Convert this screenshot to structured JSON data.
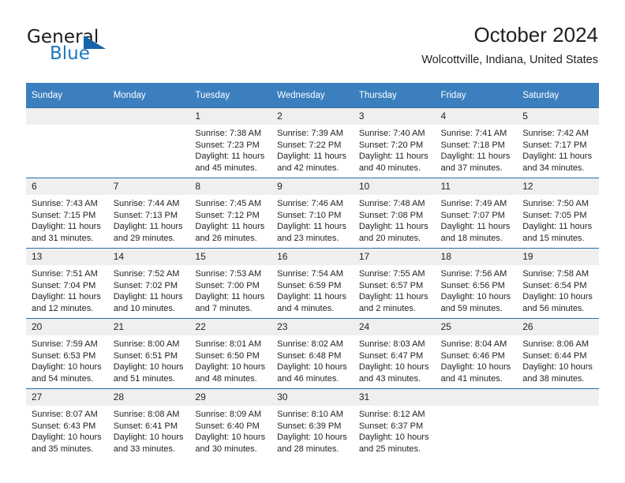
{
  "brand": {
    "name_part1": "General",
    "name_part2": "Blue",
    "triangle_icon": "triangle-icon",
    "accent_color": "#1c78c0"
  },
  "header": {
    "title": "October 2024",
    "subtitle": "Wolcottville, Indiana, United States"
  },
  "colors": {
    "header_row": "#3b7fbf",
    "row_border": "#2b6ca8",
    "daynum_background": "#efefef",
    "text": "#231f20"
  },
  "weekdays": [
    "Sunday",
    "Monday",
    "Tuesday",
    "Wednesday",
    "Thursday",
    "Friday",
    "Saturday"
  ],
  "labels": {
    "sunrise": "Sunrise:",
    "sunset": "Sunset:",
    "daylight": "Daylight:"
  },
  "weeks": [
    [
      {
        "day": "",
        "empty": true
      },
      {
        "day": "",
        "empty": true
      },
      {
        "day": "1",
        "sunrise": "Sunrise: 7:38 AM",
        "sunset": "Sunset: 7:23 PM",
        "daylight": "Daylight: 11 hours and 45 minutes."
      },
      {
        "day": "2",
        "sunrise": "Sunrise: 7:39 AM",
        "sunset": "Sunset: 7:22 PM",
        "daylight": "Daylight: 11 hours and 42 minutes."
      },
      {
        "day": "3",
        "sunrise": "Sunrise: 7:40 AM",
        "sunset": "Sunset: 7:20 PM",
        "daylight": "Daylight: 11 hours and 40 minutes."
      },
      {
        "day": "4",
        "sunrise": "Sunrise: 7:41 AM",
        "sunset": "Sunset: 7:18 PM",
        "daylight": "Daylight: 11 hours and 37 minutes."
      },
      {
        "day": "5",
        "sunrise": "Sunrise: 7:42 AM",
        "sunset": "Sunset: 7:17 PM",
        "daylight": "Daylight: 11 hours and 34 minutes."
      }
    ],
    [
      {
        "day": "6",
        "sunrise": "Sunrise: 7:43 AM",
        "sunset": "Sunset: 7:15 PM",
        "daylight": "Daylight: 11 hours and 31 minutes."
      },
      {
        "day": "7",
        "sunrise": "Sunrise: 7:44 AM",
        "sunset": "Sunset: 7:13 PM",
        "daylight": "Daylight: 11 hours and 29 minutes."
      },
      {
        "day": "8",
        "sunrise": "Sunrise: 7:45 AM",
        "sunset": "Sunset: 7:12 PM",
        "daylight": "Daylight: 11 hours and 26 minutes."
      },
      {
        "day": "9",
        "sunrise": "Sunrise: 7:46 AM",
        "sunset": "Sunset: 7:10 PM",
        "daylight": "Daylight: 11 hours and 23 minutes."
      },
      {
        "day": "10",
        "sunrise": "Sunrise: 7:48 AM",
        "sunset": "Sunset: 7:08 PM",
        "daylight": "Daylight: 11 hours and 20 minutes."
      },
      {
        "day": "11",
        "sunrise": "Sunrise: 7:49 AM",
        "sunset": "Sunset: 7:07 PM",
        "daylight": "Daylight: 11 hours and 18 minutes."
      },
      {
        "day": "12",
        "sunrise": "Sunrise: 7:50 AM",
        "sunset": "Sunset: 7:05 PM",
        "daylight": "Daylight: 11 hours and 15 minutes."
      }
    ],
    [
      {
        "day": "13",
        "sunrise": "Sunrise: 7:51 AM",
        "sunset": "Sunset: 7:04 PM",
        "daylight": "Daylight: 11 hours and 12 minutes."
      },
      {
        "day": "14",
        "sunrise": "Sunrise: 7:52 AM",
        "sunset": "Sunset: 7:02 PM",
        "daylight": "Daylight: 11 hours and 10 minutes."
      },
      {
        "day": "15",
        "sunrise": "Sunrise: 7:53 AM",
        "sunset": "Sunset: 7:00 PM",
        "daylight": "Daylight: 11 hours and 7 minutes."
      },
      {
        "day": "16",
        "sunrise": "Sunrise: 7:54 AM",
        "sunset": "Sunset: 6:59 PM",
        "daylight": "Daylight: 11 hours and 4 minutes."
      },
      {
        "day": "17",
        "sunrise": "Sunrise: 7:55 AM",
        "sunset": "Sunset: 6:57 PM",
        "daylight": "Daylight: 11 hours and 2 minutes."
      },
      {
        "day": "18",
        "sunrise": "Sunrise: 7:56 AM",
        "sunset": "Sunset: 6:56 PM",
        "daylight": "Daylight: 10 hours and 59 minutes."
      },
      {
        "day": "19",
        "sunrise": "Sunrise: 7:58 AM",
        "sunset": "Sunset: 6:54 PM",
        "daylight": "Daylight: 10 hours and 56 minutes."
      }
    ],
    [
      {
        "day": "20",
        "sunrise": "Sunrise: 7:59 AM",
        "sunset": "Sunset: 6:53 PM",
        "daylight": "Daylight: 10 hours and 54 minutes."
      },
      {
        "day": "21",
        "sunrise": "Sunrise: 8:00 AM",
        "sunset": "Sunset: 6:51 PM",
        "daylight": "Daylight: 10 hours and 51 minutes."
      },
      {
        "day": "22",
        "sunrise": "Sunrise: 8:01 AM",
        "sunset": "Sunset: 6:50 PM",
        "daylight": "Daylight: 10 hours and 48 minutes."
      },
      {
        "day": "23",
        "sunrise": "Sunrise: 8:02 AM",
        "sunset": "Sunset: 6:48 PM",
        "daylight": "Daylight: 10 hours and 46 minutes."
      },
      {
        "day": "24",
        "sunrise": "Sunrise: 8:03 AM",
        "sunset": "Sunset: 6:47 PM",
        "daylight": "Daylight: 10 hours and 43 minutes."
      },
      {
        "day": "25",
        "sunrise": "Sunrise: 8:04 AM",
        "sunset": "Sunset: 6:46 PM",
        "daylight": "Daylight: 10 hours and 41 minutes."
      },
      {
        "day": "26",
        "sunrise": "Sunrise: 8:06 AM",
        "sunset": "Sunset: 6:44 PM",
        "daylight": "Daylight: 10 hours and 38 minutes."
      }
    ],
    [
      {
        "day": "27",
        "sunrise": "Sunrise: 8:07 AM",
        "sunset": "Sunset: 6:43 PM",
        "daylight": "Daylight: 10 hours and 35 minutes."
      },
      {
        "day": "28",
        "sunrise": "Sunrise: 8:08 AM",
        "sunset": "Sunset: 6:41 PM",
        "daylight": "Daylight: 10 hours and 33 minutes."
      },
      {
        "day": "29",
        "sunrise": "Sunrise: 8:09 AM",
        "sunset": "Sunset: 6:40 PM",
        "daylight": "Daylight: 10 hours and 30 minutes."
      },
      {
        "day": "30",
        "sunrise": "Sunrise: 8:10 AM",
        "sunset": "Sunset: 6:39 PM",
        "daylight": "Daylight: 10 hours and 28 minutes."
      },
      {
        "day": "31",
        "sunrise": "Sunrise: 8:12 AM",
        "sunset": "Sunset: 6:37 PM",
        "daylight": "Daylight: 10 hours and 25 minutes."
      },
      {
        "day": "",
        "empty": true
      },
      {
        "day": "",
        "empty": true
      }
    ]
  ]
}
